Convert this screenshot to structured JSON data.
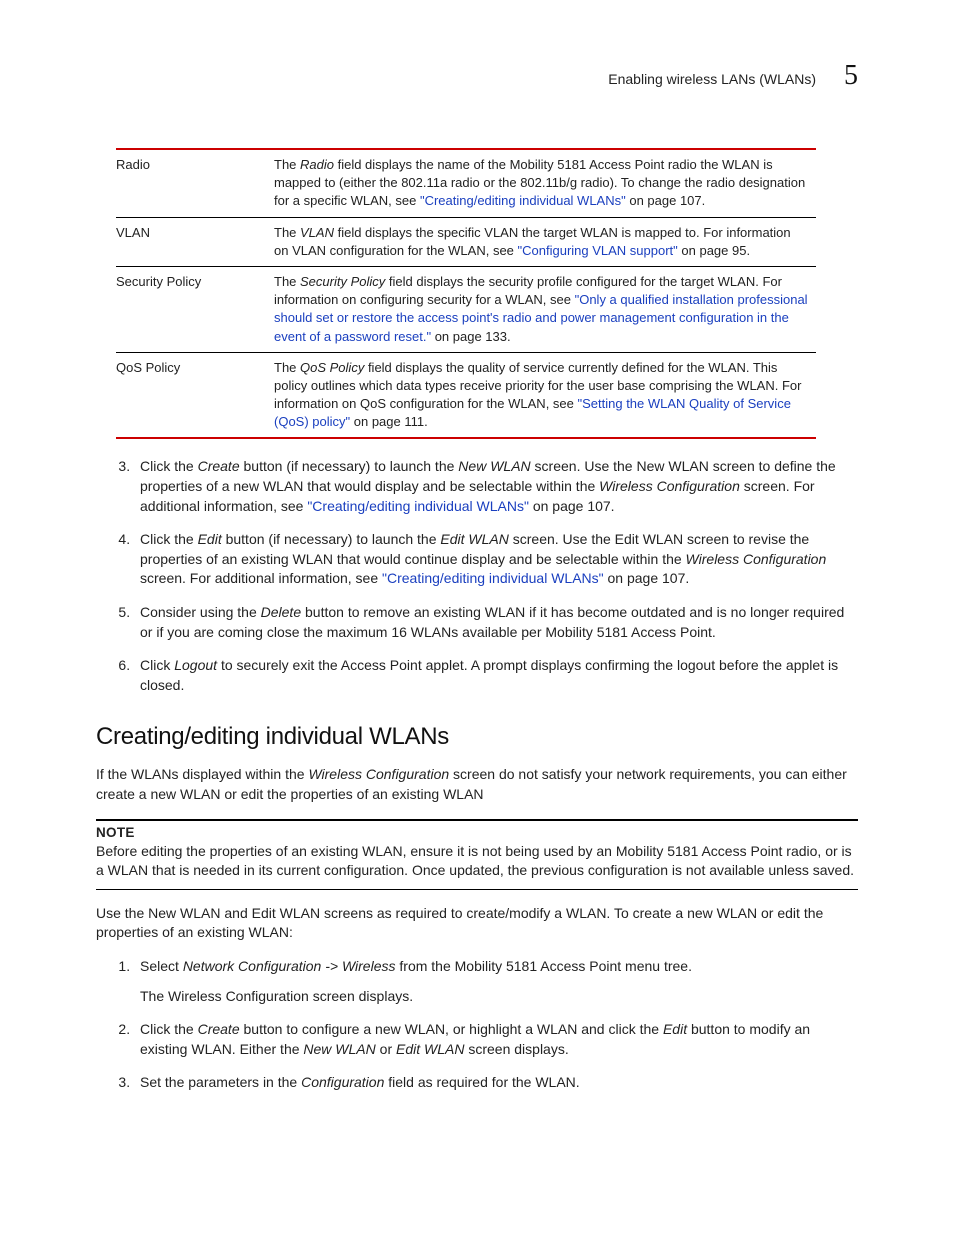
{
  "header": {
    "title": "Enabling wireless LANs (WLANs)",
    "chapter": "5"
  },
  "table": {
    "rows": [
      {
        "term": "Radio",
        "desc_pre": "The ",
        "desc_ital": "Radio",
        "desc_mid": " field displays the name of the Mobility 5181 Access Point radio the WLAN is mapped to (either the 802.11a radio or the 802.11b/g radio). To change the radio designation for a specific WLAN, see ",
        "link": "\"Creating/editing individual WLANs\"",
        "desc_tail": " on page 107."
      },
      {
        "term": "VLAN",
        "desc_pre": "The ",
        "desc_ital": "VLAN",
        "desc_mid": " field displays the specific VLAN the target WLAN is mapped to. For information on VLAN configuration for the WLAN, see ",
        "link": "\"Configuring VLAN support\"",
        "desc_tail": " on page 95."
      },
      {
        "term": "Security Policy",
        "desc_pre": "The ",
        "desc_ital": "Security Policy",
        "desc_mid": " field displays the security profile configured for the target WLAN. For information on configuring security for a WLAN, see ",
        "link": "\"Only a qualified installation professional should set or restore the access point's radio and power management configuration in the event of a password reset.\"",
        "desc_tail": " on page 133."
      },
      {
        "term": "QoS Policy",
        "desc_pre": "The ",
        "desc_ital": "QoS Policy",
        "desc_mid": " field displays the quality of service currently defined for the WLAN. This policy outlines which data types receive priority for the user base comprising the WLAN. For information on QoS configuration for the WLAN, see ",
        "link": "\"Setting the WLAN Quality of Service (QoS) policy\"",
        "desc_tail": " on page 111."
      }
    ]
  },
  "steps_a": {
    "start": 3,
    "items": [
      {
        "pre": "Click the ",
        "ital1": "Create",
        "mid1": " button (if necessary) to launch the ",
        "ital2": "New WLAN",
        "mid2": " screen. Use the New WLAN screen to define the properties of a new WLAN that would display and be selectable within the ",
        "ital3": "Wireless Configuration",
        "mid3": " screen. For additional information, see ",
        "link": "\"Creating/editing individual WLANs\"",
        "tail": " on page 107."
      },
      {
        "pre": "Click the ",
        "ital1": "Edit",
        "mid1": " button (if necessary) to launch the ",
        "ital2": "Edit WLAN",
        "mid2": " screen. Use the Edit WLAN screen to revise the properties of an existing WLAN that would continue display and be selectable within the ",
        "ital3": "Wireless Configuration",
        "mid3": " screen. For additional information, see ",
        "link": "\"Creating/editing individual WLANs\"",
        "tail": " on page 107."
      },
      {
        "pre": "Consider using the ",
        "ital1": "Delete",
        "mid1": " button to remove an existing WLAN if it has become outdated and is no longer required or if you are coming close the maximum 16 WLANs available per Mobility 5181 Access Point.",
        "ital2": "",
        "mid2": "",
        "ital3": "",
        "mid3": "",
        "link": "",
        "tail": ""
      },
      {
        "pre": "Click ",
        "ital1": "Logout",
        "mid1": " to securely exit the Access Point applet. A prompt displays confirming the logout before the applet is closed.",
        "ital2": "",
        "mid2": "",
        "ital3": "",
        "mid3": "",
        "link": "",
        "tail": ""
      }
    ]
  },
  "section": {
    "title": "Creating/editing individual WLANs",
    "intro_pre": "If the WLANs displayed within the ",
    "intro_ital": "Wireless Configuration",
    "intro_tail": " screen do not satisfy your network requirements, you can either create a new WLAN or edit the properties of an existing WLAN"
  },
  "note": {
    "label": "NOTE",
    "text": "Before editing the properties of an existing WLAN, ensure it is not being used by an Mobility 5181 Access Point radio, or is a WLAN that is needed in its current configuration. Once updated, the previous configuration is not available unless saved."
  },
  "para2": "Use the New WLAN and Edit WLAN screens as required to create/modify a WLAN. To create a new WLAN or edit the properties of an existing WLAN:",
  "steps_b": {
    "items": [
      {
        "pre": "Select ",
        "ital1": "Network Configuration -> Wireless",
        "mid1": " from the Mobility 5181 Access Point menu tree.",
        "sub": "The Wireless Configuration screen displays.",
        "ital2": "",
        "mid2": "",
        "ital3": "",
        "mid3": ""
      },
      {
        "pre": "Click the ",
        "ital1": "Create",
        "mid1": " button to configure a new WLAN, or highlight a WLAN and click the ",
        "ital2": "Edit",
        "mid2": " button to modify an existing WLAN. Either the ",
        "ital3": "New WLAN",
        "mid3": " or ",
        "ital4": "Edit WLAN",
        "mid4": " screen displays.",
        "sub": ""
      },
      {
        "pre": "Set the parameters in the ",
        "ital1": "Configuration",
        "mid1": " field as required for the WLAN.",
        "sub": "",
        "ital2": "",
        "mid2": "",
        "ital3": "",
        "mid3": ""
      }
    ]
  }
}
